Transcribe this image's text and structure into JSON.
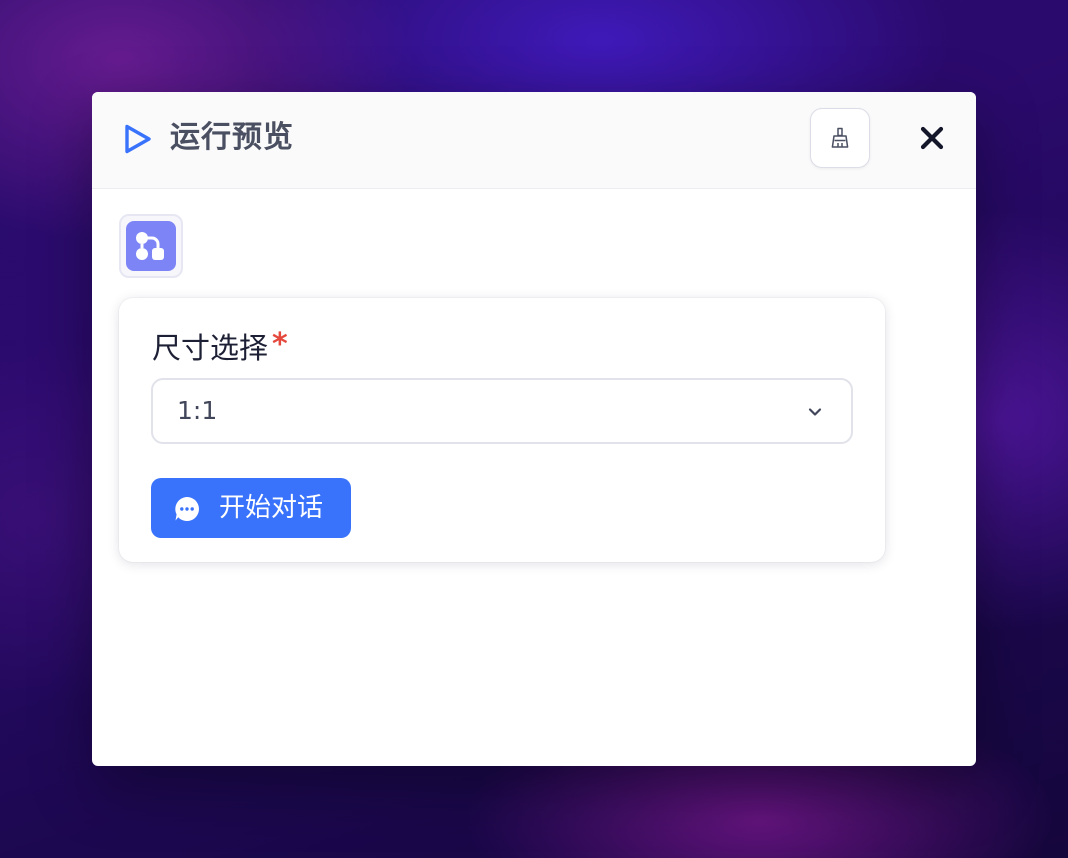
{
  "header": {
    "title": "运行预览",
    "play_icon": "play-icon",
    "clear_icon": "broom-icon",
    "close_icon": "close-icon",
    "accent_color": "#3a73fb"
  },
  "workflow": {
    "icon": "workflow-icon",
    "color": "#7d85f6"
  },
  "form": {
    "field_label": "尺寸选择",
    "required_mark": "*",
    "select_value": "1:1",
    "select_icon": "chevron-down-icon",
    "submit_label": "开始对话",
    "submit_icon": "chat-bubble-icon"
  }
}
